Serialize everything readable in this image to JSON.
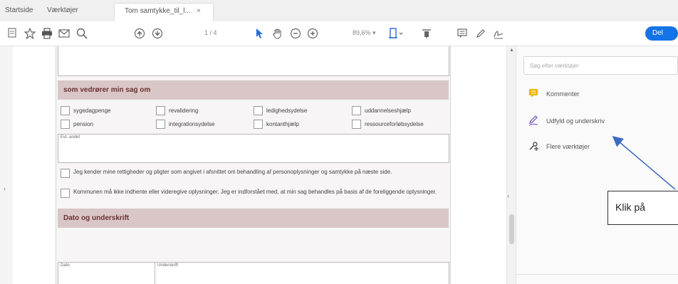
{
  "browser": {
    "tabs": [
      {
        "label": "Startside"
      },
      {
        "label": "Værktøjer"
      },
      {
        "label": "Tom samtykke_til_l...",
        "close": "×"
      }
    ]
  },
  "toolbar": {
    "page_indicator": "1 / 4",
    "zoom_level": "89,6%",
    "share_label": "Del",
    "accent_color": "#1473e6"
  },
  "form": {
    "section_header": "som vedrører min sag om",
    "checkboxes": [
      {
        "label": "sygedagpenge"
      },
      {
        "label": "revalidering"
      },
      {
        "label": "ledighedsydelse"
      },
      {
        "label": "uddannelseshjælp"
      },
      {
        "label": "pension"
      },
      {
        "label": "integrationsydelse"
      },
      {
        "label": "kontanthjælp"
      },
      {
        "label": "ressourceforløbsydelse"
      }
    ],
    "other_label": "Evt. andet",
    "consent_1": "Jeg kender mine rettigheder og pligter som angivet i afsnittet om behandling af personoplysninger og samtykke på næste side.",
    "consent_2": "Kommunen må ikke indhente eller videregive oplysninger. Jeg er indforstået med, at min sag behandles på basis af de foreliggende oplysninger.",
    "date_section": "Dato og underskrift",
    "date_label": "Dato",
    "signature_label": "Underskrift"
  },
  "right_panel": {
    "search_placeholder": "Søg efter værktøjer",
    "tools": [
      {
        "label": "Kommenter",
        "icon": "comment-icon",
        "color": "#f0b400"
      },
      {
        "label": "Udfyld og underskriv",
        "icon": "fill-sign-icon",
        "color": "#8a6bd1"
      },
      {
        "label": "Flere værktøjer",
        "icon": "more-tools-icon",
        "color": "#555555"
      }
    ]
  },
  "annotation": {
    "callout_text": "Klik på"
  }
}
